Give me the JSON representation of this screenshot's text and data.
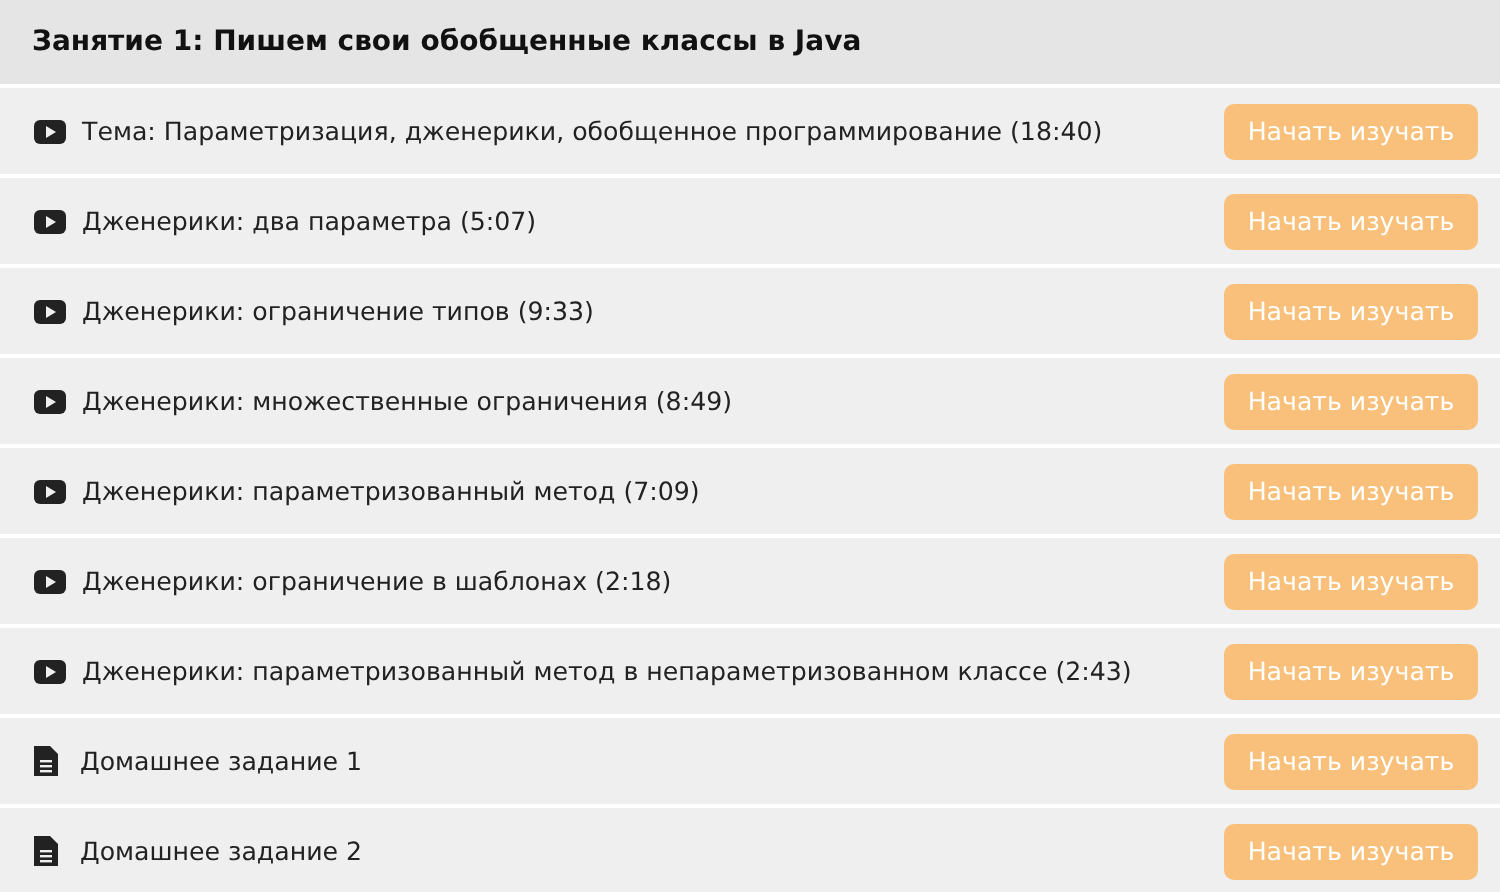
{
  "lesson": {
    "title": "Занятие 1: Пишем свои обобщенные классы в Java"
  },
  "items": [
    {
      "kind": "video",
      "title": "Тема: Параметризация, дженерики, обобщенное программирование (18:40)",
      "button": "Начать изучать"
    },
    {
      "kind": "video",
      "title": "Дженерики: два параметра (5:07)",
      "button": "Начать изучать"
    },
    {
      "kind": "video",
      "title": "Дженерики: ограничение типов (9:33)",
      "button": "Начать изучать"
    },
    {
      "kind": "video",
      "title": "Дженерики: множественные ограничения (8:49)",
      "button": "Начать изучать"
    },
    {
      "kind": "video",
      "title": "Дженерики: параметризованный метод (7:09)",
      "button": "Начать изучать"
    },
    {
      "kind": "video",
      "title": "Дженерики: ограничение в шаблонах (2:18)",
      "button": "Начать изучать"
    },
    {
      "kind": "video",
      "title": "Дженерики: параметризованный метод в непараметризованном классе (2:43)",
      "button": "Начать изучать"
    },
    {
      "kind": "document",
      "title": "Домашнее задание 1",
      "button": "Начать изучать"
    },
    {
      "kind": "document",
      "title": "Домашнее задание 2",
      "button": "Начать изучать"
    }
  ]
}
